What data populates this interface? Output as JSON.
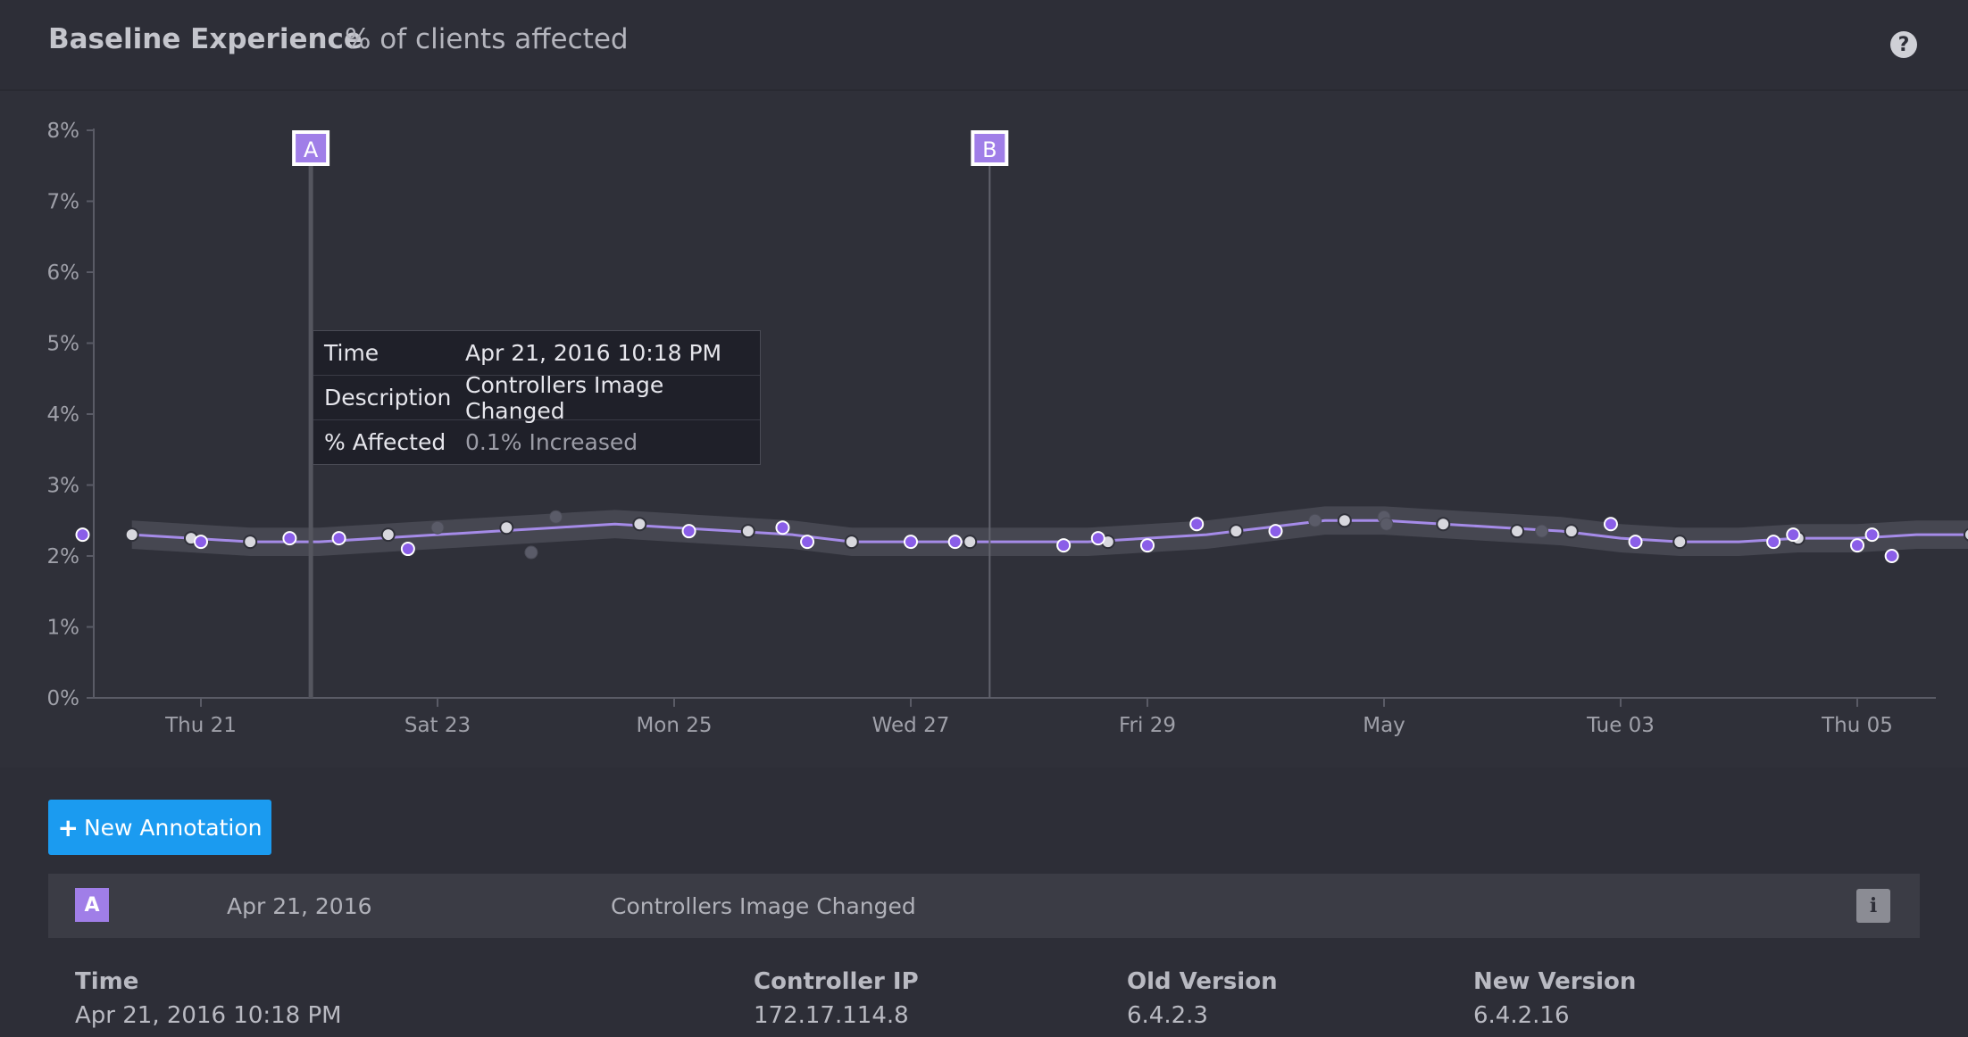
{
  "header": {
    "title": "Baseline Experience",
    "subtitle": "% of clients affected",
    "help_icon": "?"
  },
  "chart_data": {
    "type": "line",
    "ylabel": "",
    "ylim": [
      0,
      8
    ],
    "yticks": [
      "0%",
      "1%",
      "2%",
      "3%",
      "4%",
      "5%",
      "6%",
      "7%",
      "8%"
    ],
    "xticks": [
      "Thu 21",
      "Sat 23",
      "Mon 25",
      "Wed 27",
      "Fri 29",
      "May",
      "Tue 03",
      "Thu 05"
    ],
    "x_domain": [
      "2016-04-20",
      "2016-05-06"
    ],
    "series": [
      {
        "type": "line_with_band",
        "points": [
          [
            "2016-04-20T10:00",
            2.3
          ],
          [
            "2016-04-20T22:00",
            2.25
          ],
          [
            "2016-04-21T10:00",
            2.2
          ],
          [
            "2016-04-22T00:00",
            2.2
          ],
          [
            "2016-04-22T12:00",
            2.25
          ],
          [
            "2016-04-23T00:00",
            2.3
          ],
          [
            "2016-04-23T12:00",
            2.35
          ],
          [
            "2016-04-24T00:00",
            2.4
          ],
          [
            "2016-04-24T12:00",
            2.45
          ],
          [
            "2016-04-25T00:00",
            2.4
          ],
          [
            "2016-04-25T12:00",
            2.35
          ],
          [
            "2016-04-26T00:00",
            2.3
          ],
          [
            "2016-04-26T12:00",
            2.2
          ],
          [
            "2016-04-27T00:00",
            2.2
          ],
          [
            "2016-04-27T12:00",
            2.2
          ],
          [
            "2016-04-28T00:00",
            2.2
          ],
          [
            "2016-04-28T12:00",
            2.2
          ],
          [
            "2016-04-29T00:00",
            2.25
          ],
          [
            "2016-04-29T12:00",
            2.3
          ],
          [
            "2016-04-30T00:00",
            2.4
          ],
          [
            "2016-04-30T12:00",
            2.5
          ],
          [
            "2016-05-01T00:00",
            2.5
          ],
          [
            "2016-05-01T12:00",
            2.45
          ],
          [
            "2016-05-02T00:00",
            2.4
          ],
          [
            "2016-05-02T12:00",
            2.35
          ],
          [
            "2016-05-03T00:00",
            2.25
          ],
          [
            "2016-05-03T12:00",
            2.2
          ],
          [
            "2016-05-04T00:00",
            2.2
          ],
          [
            "2016-05-04T12:00",
            2.25
          ],
          [
            "2016-05-05T00:00",
            2.25
          ],
          [
            "2016-05-05T12:00",
            2.3
          ],
          [
            "2016-05-05T23:00",
            2.3
          ]
        ],
        "band_halfwidth": 0.2
      },
      {
        "type": "scatter_purple",
        "points": [
          [
            "2016-04-20T00:00",
            2.3
          ],
          [
            "2016-04-21T00:00",
            2.2
          ],
          [
            "2016-04-21T18:00",
            2.25
          ],
          [
            "2016-04-22T04:00",
            2.25
          ],
          [
            "2016-04-22T18:00",
            2.1
          ],
          [
            "2016-04-25T03:00",
            2.35
          ],
          [
            "2016-04-25T22:00",
            2.4
          ],
          [
            "2016-04-26T03:00",
            2.2
          ],
          [
            "2016-04-27T00:00",
            2.2
          ],
          [
            "2016-04-27T09:00",
            2.2
          ],
          [
            "2016-04-28T07:00",
            2.15
          ],
          [
            "2016-04-28T14:00",
            2.25
          ],
          [
            "2016-04-29T00:00",
            2.15
          ],
          [
            "2016-04-29T10:00",
            2.45
          ],
          [
            "2016-04-30T02:00",
            2.35
          ],
          [
            "2016-05-02T22:00",
            2.45
          ],
          [
            "2016-05-03T03:00",
            2.2
          ],
          [
            "2016-05-04T07:00",
            2.2
          ],
          [
            "2016-05-04T11:00",
            2.3
          ],
          [
            "2016-05-05T00:00",
            2.15
          ],
          [
            "2016-05-05T03:00",
            2.3
          ],
          [
            "2016-05-05T07:00",
            2.0
          ]
        ]
      },
      {
        "type": "scatter_white",
        "points": [
          [
            "2016-04-20T10:00",
            2.3
          ],
          [
            "2016-04-20T22:00",
            2.25
          ],
          [
            "2016-04-21T10:00",
            2.2
          ],
          [
            "2016-04-22T14:00",
            2.3
          ],
          [
            "2016-04-23T14:00",
            2.4
          ],
          [
            "2016-04-24T17:00",
            2.45
          ],
          [
            "2016-04-25T15:00",
            2.35
          ],
          [
            "2016-04-26T12:00",
            2.2
          ],
          [
            "2016-04-27T12:00",
            2.2
          ],
          [
            "2016-04-28T16:00",
            2.2
          ],
          [
            "2016-04-29T18:00",
            2.35
          ],
          [
            "2016-04-30T16:00",
            2.5
          ],
          [
            "2016-05-01T12:00",
            2.45
          ],
          [
            "2016-05-02T03:00",
            2.35
          ],
          [
            "2016-05-02T14:00",
            2.35
          ],
          [
            "2016-05-03T12:00",
            2.2
          ],
          [
            "2016-05-04T12:00",
            2.25
          ],
          [
            "2016-05-05T23:00",
            2.3
          ]
        ]
      },
      {
        "type": "scatter_faint",
        "points": [
          [
            "2016-04-23T00:00",
            2.4
          ],
          [
            "2016-04-23T19:00",
            2.05
          ],
          [
            "2016-04-24T00:00",
            2.55
          ],
          [
            "2016-04-30T10:00",
            2.5
          ],
          [
            "2016-05-01T00:00",
            2.55
          ],
          [
            "2016-05-01T00:30",
            2.45
          ],
          [
            "2016-05-02T08:00",
            2.35
          ]
        ]
      }
    ],
    "annotations": [
      {
        "label": "A",
        "x": "2016-04-21T22:18"
      },
      {
        "label": "B",
        "x": "2016-04-27T16:00"
      }
    ],
    "grid": false
  },
  "tooltip": {
    "rows": [
      {
        "key": "Time",
        "value": "Apr 21, 2016 10:18 PM"
      },
      {
        "key": "Description",
        "value": "Controllers Image Changed"
      },
      {
        "key": "% Affected",
        "value": "0.1% Increased"
      }
    ]
  },
  "new_annotation": {
    "label": "New Annotation",
    "icon": "plus-icon"
  },
  "annotation_row": {
    "badge": "A",
    "date": "Apr 21, 2016",
    "description": "Controllers Image Changed",
    "info_icon": "i"
  },
  "details": [
    {
      "label": "Time",
      "value": "Apr 21, 2016 10:18 PM"
    },
    {
      "label": "Controller IP",
      "value": "172.17.114.8"
    },
    {
      "label": "Old Version",
      "value": "6.4.2.3"
    },
    {
      "label": "New Version",
      "value": "6.4.2.16"
    }
  ],
  "colors": {
    "line": "#a58be8",
    "band": "#4a4b56",
    "dot_purple": "#8a5ee8",
    "dot_white": "#d8d8de",
    "annotation": "#a07ee8",
    "accent": "#1b9bf0"
  }
}
